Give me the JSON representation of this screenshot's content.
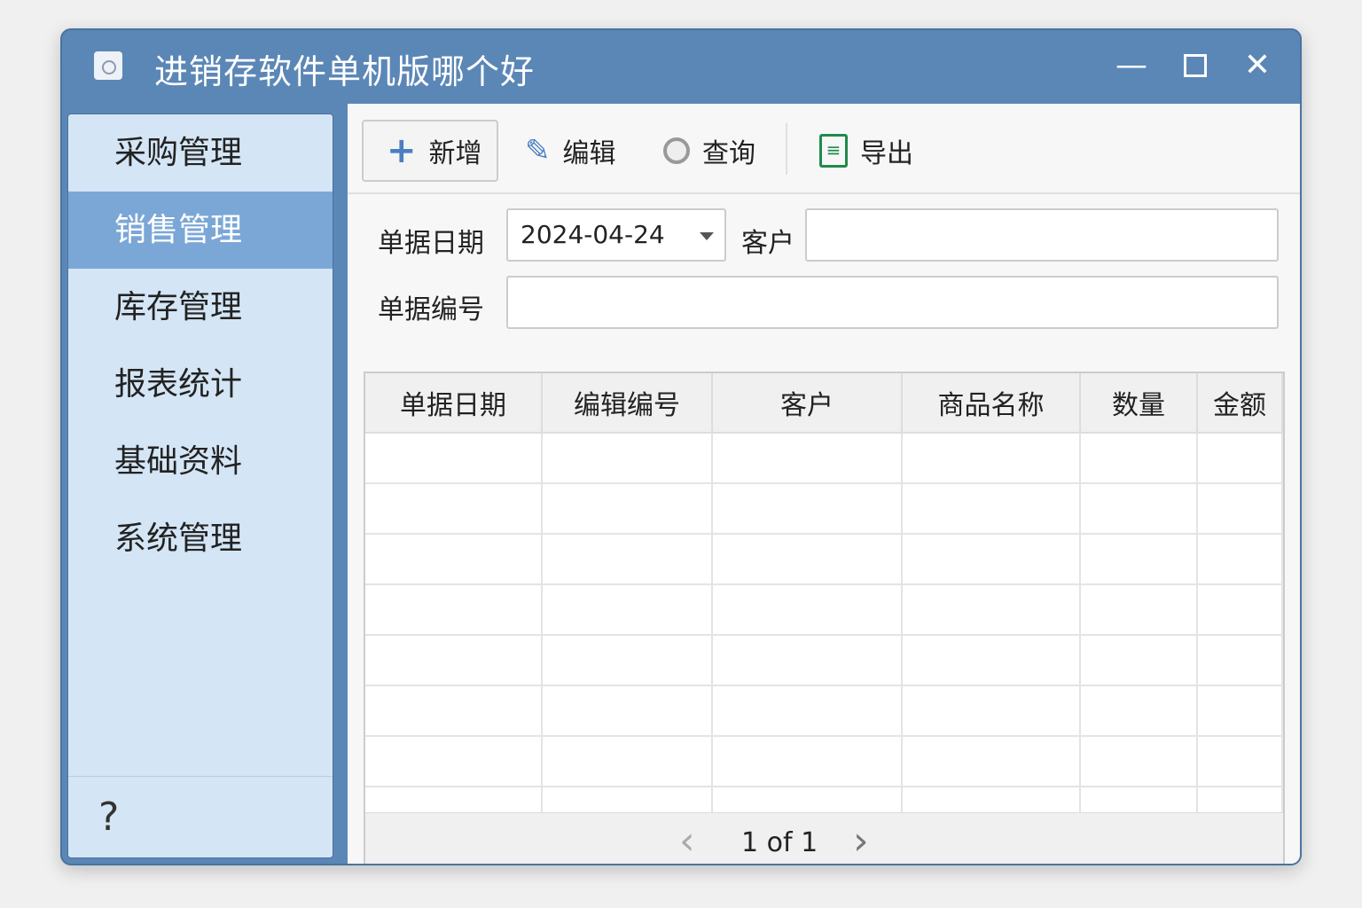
{
  "window": {
    "title": "进销存软件单机版哪个好",
    "minimize": "—",
    "maximize": "☐",
    "close": "✕"
  },
  "sidebar": {
    "items": [
      {
        "label": "采购管理"
      },
      {
        "label": "销售管理",
        "active": true
      },
      {
        "label": "库存管理"
      },
      {
        "label": "报表统计"
      },
      {
        "label": "基础资料"
      },
      {
        "label": "系统管理"
      }
    ],
    "help": "?"
  },
  "toolbar": {
    "add": "新增",
    "edit": "编辑",
    "query": "查询",
    "export": "导出"
  },
  "form": {
    "date_label": "单据日期",
    "date_value": "2024-04-24",
    "customer_label": "客户",
    "customer_value": "",
    "number_label": "单据编号",
    "number_value": ""
  },
  "table": {
    "columns": [
      "单据日期",
      "编辑编号",
      "客户",
      "商品名称",
      "数量",
      "金额"
    ],
    "rows": []
  },
  "pager": {
    "text": "1 of 1",
    "prev": "‹",
    "next": "›"
  }
}
